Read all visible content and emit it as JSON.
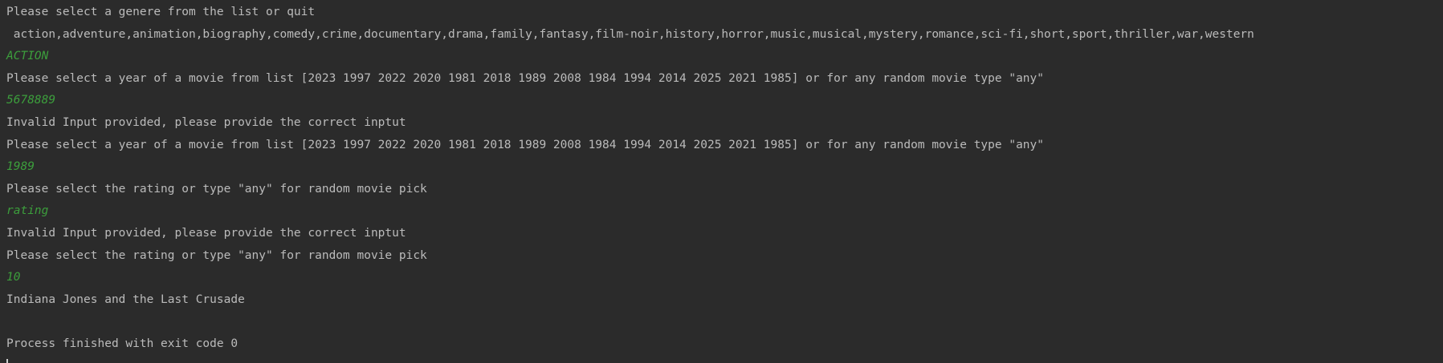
{
  "console": {
    "lines": [
      {
        "text": "Please select a genere from the list or quit",
        "kind": "output"
      },
      {
        "text": " action,adventure,animation,biography,comedy,crime,documentary,drama,family,fantasy,film-noir,history,horror,music,musical,mystery,romance,sci-fi,short,sport,thriller,war,western",
        "kind": "output"
      },
      {
        "text": "ACTION",
        "kind": "input"
      },
      {
        "text": "Please select a year of a movie from list [2023 1997 2022 2020 1981 2018 1989 2008 1984 1994 2014 2025 2021 1985] or for any random movie type \"any\"",
        "kind": "output"
      },
      {
        "text": "5678889",
        "kind": "input"
      },
      {
        "text": "Invalid Input provided, please provide the correct inptut",
        "kind": "output"
      },
      {
        "text": "Please select a year of a movie from list [2023 1997 2022 2020 1981 2018 1989 2008 1984 1994 2014 2025 2021 1985] or for any random movie type \"any\"",
        "kind": "output"
      },
      {
        "text": "1989",
        "kind": "input"
      },
      {
        "text": "Please select the rating or type \"any\" for random movie pick",
        "kind": "output"
      },
      {
        "text": "rating",
        "kind": "input"
      },
      {
        "text": "Invalid Input provided, please provide the correct inptut",
        "kind": "output"
      },
      {
        "text": "Please select the rating or type \"any\" for random movie pick",
        "kind": "output"
      },
      {
        "text": "10",
        "kind": "input"
      },
      {
        "text": "Indiana Jones and the Last Crusade",
        "kind": "output"
      },
      {
        "text": "",
        "kind": "output"
      },
      {
        "text": "Process finished with exit code 0",
        "kind": "output"
      }
    ]
  },
  "colors": {
    "background": "#2b2b2b",
    "output_text": "#bbbbbb",
    "input_text": "#3c9e3c"
  }
}
